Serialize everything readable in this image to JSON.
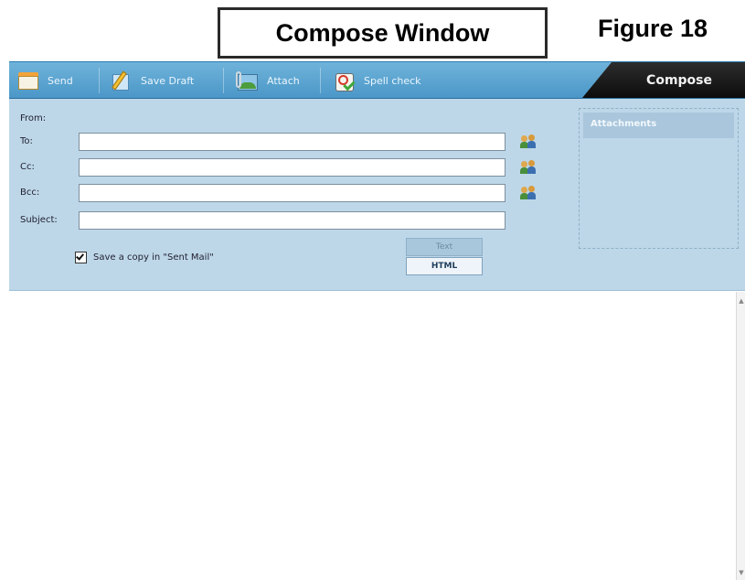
{
  "figure": {
    "title": "Compose Window",
    "label": "Figure 18"
  },
  "toolbar": {
    "send_label": "Send",
    "save_draft_label": "Save Draft",
    "attach_label": "Attach",
    "spell_check_label": "Spell check",
    "compose_tab_label": "Compose"
  },
  "fields": {
    "from_label": "From:",
    "to_label": "To:",
    "cc_label": "Cc:",
    "bcc_label": "Bcc:",
    "subject_label": "Subject:",
    "to_value": "",
    "cc_value": "",
    "bcc_value": "",
    "subject_value": ""
  },
  "options": {
    "save_copy_label": "Save a copy in \"Sent Mail\"",
    "save_copy_checked": true,
    "format_text_label": "Text",
    "format_html_label": "HTML"
  },
  "attachments": {
    "title": "Attachments"
  },
  "colors": {
    "toolbar_blue": "#5aa6d3",
    "header_panel": "#bdd7e8",
    "compose_tab": "#111111"
  }
}
